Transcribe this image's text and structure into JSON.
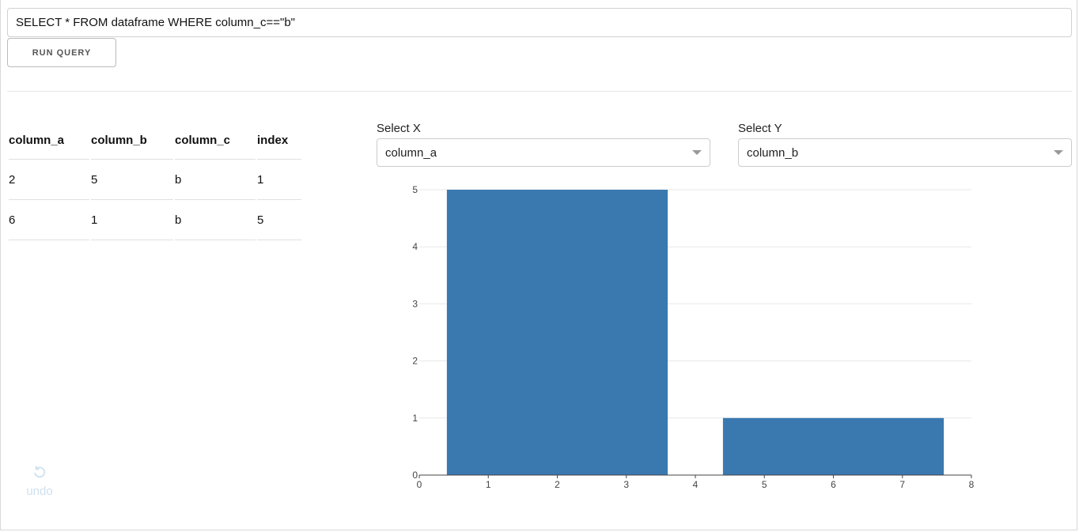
{
  "query": {
    "value": "SELECT * FROM dataframe WHERE column_c==\"b\""
  },
  "run_button": {
    "label": "RUN QUERY"
  },
  "table": {
    "headers": [
      "column_a",
      "column_b",
      "column_c",
      "index"
    ],
    "rows": [
      [
        "2",
        "5",
        "b",
        "1"
      ],
      [
        "6",
        "1",
        "b",
        "5"
      ]
    ]
  },
  "select_x": {
    "label": "Select X",
    "value": "column_a"
  },
  "select_y": {
    "label": "Select Y",
    "value": "column_b"
  },
  "undo": {
    "label": "undo",
    "icon": "undo-icon"
  },
  "colors": {
    "bar": "#3a79b0",
    "undo": "#cfe0ee"
  },
  "chart_data": {
    "type": "bar",
    "x": [
      2,
      6
    ],
    "values": [
      5,
      1
    ],
    "bar_width": 3.2,
    "xlim": [
      0,
      8
    ],
    "ylim": [
      0,
      5
    ],
    "xticks": [
      0,
      1,
      2,
      3,
      4,
      5,
      6,
      7,
      8
    ],
    "yticks": [
      0,
      1,
      2,
      3,
      4,
      5
    ],
    "grid": true,
    "title": "",
    "xlabel": "",
    "ylabel": ""
  }
}
